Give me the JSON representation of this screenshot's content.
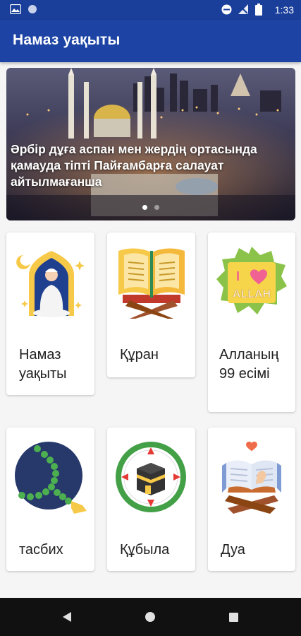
{
  "status": {
    "time": "1:33"
  },
  "app": {
    "title": "Намаз уақыты"
  },
  "banner": {
    "text": "Әрбір дұға аспан мен жердің ортасында қамауда тіпті Пайғамбарға салауат айтылмағанша"
  },
  "cards": {
    "prayer_times": "Намаз уақыты",
    "quran": "Құран",
    "allah_names": "Алланың 99 есімі",
    "tasbih": "тасбих",
    "qibla": "Құбыла",
    "dua": "Дуа"
  },
  "icons": {
    "heart_text": "I",
    "allah_text": "ALLAH"
  },
  "colors": {
    "primary": "#1d44a4",
    "statusbar": "#1a3f9a",
    "accent_yellow": "#f7c948"
  }
}
